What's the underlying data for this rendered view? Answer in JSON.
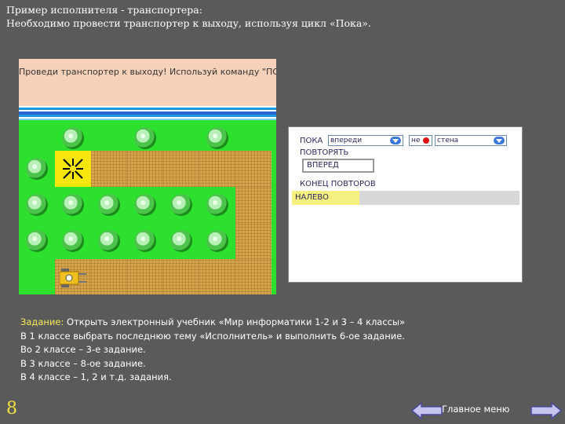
{
  "slide": {
    "title_line1": "Пример исполнителя - транспортера:",
    "title_line2": "Необходимо провести транспортер к выходу, используя цикл «Пока».",
    "page_number": "8",
    "main_menu_label": "Главное меню"
  },
  "game": {
    "banner_text": "Проведи транспортер к выходу! Используй команду \"ПОКА\"."
  },
  "program": {
    "line1_keyword": "ПОКА",
    "condition_select": "впереди",
    "not_select": "не",
    "object_select": "стена",
    "line2": "ПОВТОРЯТЬ",
    "command_box": "ВПЕРЕД",
    "line4": "КОНЕЦ ПОВТОРОВ",
    "status_command": "НАЛЕВО"
  },
  "task": {
    "label": "Задание:",
    "line1": "Открыть электронный учебник «Мир информатики 1-2 и 3 – 4 классы»",
    "line2": "В 1 классе выбрать последнюю тему «Исполнитель» и выполнить 6-ое задание.",
    "line3": "Во 2 классе – 3-е задание.",
    "line4": "В 3 классе – 8-ое задание.",
    "line5": "В 4 классе – 1, 2 и т.д. задания."
  },
  "colors": {
    "background": "#5a5a5a",
    "grass": "#2ee02e",
    "path": "#d7a44a",
    "task_label": "#f7ea55",
    "page_number": "#f0e040"
  },
  "icons": {
    "prev": "left-arrow-icon",
    "next": "right-arrow-icon",
    "target": "target-cross-icon",
    "robot": "conveyor-robot-icon"
  }
}
